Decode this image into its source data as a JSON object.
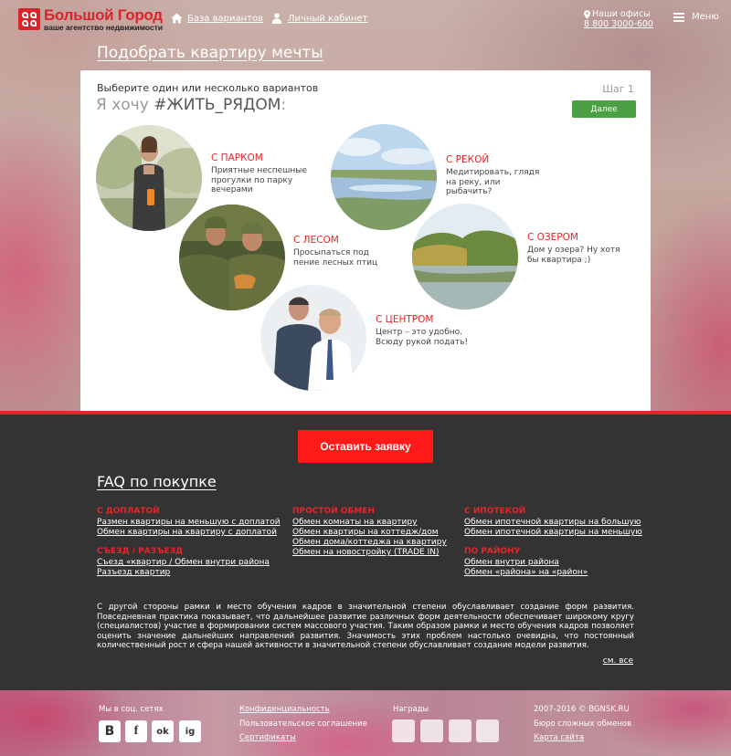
{
  "header": {
    "logo_title": "Большой Город",
    "logo_subtitle": "ваше агентство недвижимости",
    "nav": [
      {
        "label": "База вариантов",
        "icon": "home-icon"
      },
      {
        "label": "Личный кабинет",
        "icon": "user-icon"
      }
    ],
    "offices_label": "Наши офисы",
    "phone": "8 800 3000-600",
    "menu_label": "Меню"
  },
  "headline": {
    "w1": "Подобрать",
    "w2": "квартиру",
    "w3": "мечты"
  },
  "card": {
    "subtitle": "Выберите один или несколько вариантов",
    "title_prefix": "Я хочу ",
    "title_hash": "#ЖИТЬ_РЯДОМ",
    "title_suffix": ":",
    "step": "Шаг 1",
    "next_label": "Далее",
    "options": [
      {
        "title": "С ПАРКОМ",
        "desc": "Приятные неспешные прогулки по парку вечерами"
      },
      {
        "title": "С РЕКОЙ",
        "desc": "Медитировать, глядя на реку, или рыбачить?"
      },
      {
        "title": "С ЛЕСОМ",
        "desc": "Просыпаться под пение лесных птиц"
      },
      {
        "title": "С ОЗЕРОМ",
        "desc": "Дом у озера? Ну хотя бы квартира ;)"
      },
      {
        "title": "С ЦЕНТРОМ",
        "desc": "Центр – это удобно. Всюду рукой подать!"
      }
    ]
  },
  "apply_label": "Оставить заявку",
  "faq": {
    "title": "FAQ по покупке",
    "col1": [
      {
        "heading": "С ДОПЛАТОЙ",
        "links": [
          "Размен квартиры на меньшую с доплатой",
          "Обмен квартиры на квартиру с доплатой"
        ]
      },
      {
        "heading": "СЪЕЗД / РАЗЪЕЗД",
        "links": [
          "Съезд «квартир / Обмен внутри района",
          "Разъезд квартир"
        ]
      }
    ],
    "col2": [
      {
        "heading": "ПРОСТОЙ ОБМЕН",
        "links": [
          "Обмен комнаты на квартиру",
          "Обмен квартиры на коттедж/дом",
          "Обмен дома/коттеджа на квартиру",
          "Обмен на новостройку (TRADE IN)"
        ]
      }
    ],
    "col3": [
      {
        "heading": "С ИПОТЕКОЙ",
        "links": [
          "Обмен ипотечной квартиры на большую",
          "Обмен ипотечной квартиры на меньшую"
        ]
      },
      {
        "heading": "ПО РАЙОНУ",
        "links": [
          "Обмен внутри района",
          "Обмен «района» на «район»"
        ]
      }
    ],
    "paragraph": "С другой стороны рамки и место обучения кадров в значительной степени обуславливает создание форм развития. Повседневная практика показывает, что дальнейшее развитие различных форм деятельности обеспечивает широкому кругу (специалистов) участие в формировании систем массового участия. Таким образом рамки и место обучения кадров позволяет оценить значение дальнейших направлений развития. Значимость этих проблем настолько очевидна, что постоянный количественный рост и сфера нашей активности в значительной степени обуславливает создание модели развития.",
    "see_all": "см. все"
  },
  "footer": {
    "social_label": "Мы в соц. сетях",
    "social": [
      {
        "glyph": "В",
        "icon": "vk-icon"
      },
      {
        "glyph": "f",
        "icon": "facebook-icon"
      },
      {
        "glyph": "ok",
        "icon": "odnoklassniki-icon"
      },
      {
        "glyph": "ig",
        "icon": "instagram-icon"
      }
    ],
    "links": [
      "Конфиденциальность",
      "Пользовательское соглашение",
      "Сертификаты"
    ],
    "awards_label": "Награды",
    "copyright": "2007-2016 © BGNSK.RU",
    "studio": "Бюро сложных обменов",
    "sitemap": "Карта сайта"
  }
}
